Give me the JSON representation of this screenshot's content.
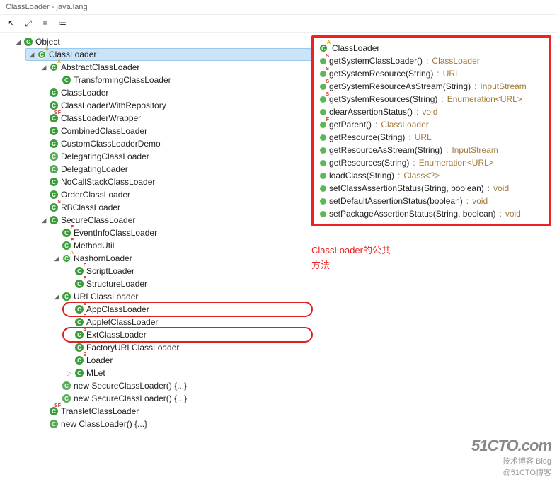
{
  "title": "ClassLoader - java.lang",
  "toolbar": {
    "btn1": "↖",
    "btn2": "⤢",
    "btn3": "≡",
    "btn4": "≔"
  },
  "tree": [
    {
      "d": 0,
      "e": "open",
      "ico": "class",
      "lbl": "Object"
    },
    {
      "d": 1,
      "e": "open",
      "ico": "abs",
      "badge": "A",
      "lbl": "ClassLoader",
      "sel": true
    },
    {
      "d": 2,
      "e": "open",
      "ico": "abs",
      "badge": "A",
      "lbl": "AbstractClassLoader"
    },
    {
      "d": 3,
      "e": "",
      "ico": "class",
      "badge": "",
      "lbl": "TransformingClassLoader"
    },
    {
      "d": 2,
      "e": "",
      "ico": "class",
      "badge": "",
      "lbl": "ClassLoader"
    },
    {
      "d": 2,
      "e": "",
      "ico": "class",
      "badge": "",
      "lbl": "ClassLoaderWithRepository"
    },
    {
      "d": 2,
      "e": "",
      "ico": "class",
      "badge": "SF",
      "lbl": "ClassLoaderWrapper"
    },
    {
      "d": 2,
      "e": "",
      "ico": "class",
      "badge": "",
      "lbl": "CombinedClassLoader"
    },
    {
      "d": 2,
      "e": "",
      "ico": "class",
      "badge": "",
      "lbl": "CustomClassLoaderDemo"
    },
    {
      "d": 2,
      "e": "",
      "ico": "anon",
      "badge": "",
      "lbl": "DelegatingClassLoader"
    },
    {
      "d": 2,
      "e": "",
      "ico": "anon",
      "badge": "",
      "lbl": "DelegatingLoader"
    },
    {
      "d": 2,
      "e": "",
      "ico": "class",
      "badge": "",
      "lbl": "NoCallStackClassLoader"
    },
    {
      "d": 2,
      "e": "",
      "ico": "class",
      "badge": "",
      "lbl": "OrderClassLoader"
    },
    {
      "d": 2,
      "e": "",
      "ico": "class",
      "badge": "S",
      "lbl": "RBClassLoader"
    },
    {
      "d": 2,
      "e": "open",
      "ico": "class",
      "badge": "",
      "lbl": "SecureClassLoader"
    },
    {
      "d": 3,
      "e": "",
      "ico": "class",
      "badge": "F",
      "lbl": "EventInfoClassLoader"
    },
    {
      "d": 3,
      "e": "",
      "ico": "class",
      "badge": "F",
      "lbl": "MethodUtil"
    },
    {
      "d": 3,
      "e": "open",
      "ico": "abs",
      "badge": "A",
      "lbl": "NashornLoader"
    },
    {
      "d": 4,
      "e": "",
      "ico": "class",
      "badge": "F",
      "lbl": "ScriptLoader"
    },
    {
      "d": 4,
      "e": "",
      "ico": "class",
      "badge": "F",
      "lbl": "StructureLoader"
    },
    {
      "d": 3,
      "e": "open",
      "ico": "class",
      "badge": "",
      "lbl": "URLClassLoader"
    },
    {
      "d": 4,
      "e": "",
      "ico": "class",
      "badge": "S",
      "lbl": "AppClassLoader",
      "hl": true
    },
    {
      "d": 4,
      "e": "",
      "ico": "class",
      "badge": "F",
      "lbl": "AppletClassLoader"
    },
    {
      "d": 4,
      "e": "",
      "ico": "class",
      "badge": "S",
      "lbl": "ExtClassLoader",
      "hl": true
    },
    {
      "d": 4,
      "e": "",
      "ico": "class",
      "badge": "F",
      "lbl": "FactoryURLClassLoader"
    },
    {
      "d": 4,
      "e": "",
      "ico": "class",
      "badge": "S",
      "lbl": "Loader"
    },
    {
      "d": 4,
      "e": "closed",
      "ico": "class",
      "badge": "",
      "lbl": "MLet"
    },
    {
      "d": 3,
      "e": "",
      "ico": "anon",
      "badge": "",
      "lbl": "new SecureClassLoader() {...}"
    },
    {
      "d": 3,
      "e": "",
      "ico": "anon",
      "badge": "",
      "lbl": "new SecureClassLoader() {...}"
    },
    {
      "d": 2,
      "e": "",
      "ico": "class",
      "badge": "SF",
      "lbl": "TransletClassLoader"
    },
    {
      "d": 2,
      "e": "",
      "ico": "anon",
      "badge": "",
      "lbl": "new ClassLoader() {...}"
    }
  ],
  "members_header": {
    "badge": "A",
    "lbl": "ClassLoader"
  },
  "members": [
    {
      "badge": "S",
      "sig": "getSystemClassLoader()",
      "ret": "ClassLoader"
    },
    {
      "badge": "S",
      "sig": "getSystemResource(String)",
      "ret": "URL"
    },
    {
      "badge": "S",
      "sig": "getSystemResourceAsStream(String)",
      "ret": "InputStream"
    },
    {
      "badge": "S",
      "sig": "getSystemResources(String)",
      "ret": "Enumeration<URL>"
    },
    {
      "badge": "",
      "sig": "clearAssertionStatus()",
      "ret": "void"
    },
    {
      "badge": "F",
      "sig": "getParent()",
      "ret": "ClassLoader"
    },
    {
      "badge": "",
      "sig": "getResource(String)",
      "ret": "URL"
    },
    {
      "badge": "",
      "sig": "getResourceAsStream(String)",
      "ret": "InputStream"
    },
    {
      "badge": "",
      "sig": "getResources(String)",
      "ret": "Enumeration<URL>"
    },
    {
      "badge": "",
      "sig": "loadClass(String)",
      "ret": "Class<?>"
    },
    {
      "badge": "",
      "sig": "setClassAssertionStatus(String, boolean)",
      "ret": "void"
    },
    {
      "badge": "",
      "sig": "setDefaultAssertionStatus(boolean)",
      "ret": "void"
    },
    {
      "badge": "",
      "sig": "setPackageAssertionStatus(String, boolean)",
      "ret": "void"
    }
  ],
  "annotation": {
    "line1": "ClassLoader的公共",
    "line2": "方法"
  },
  "watermark": {
    "big": "51CTO.com",
    "small": "技术博客   Blog",
    "sub": "@51CTO博客"
  }
}
